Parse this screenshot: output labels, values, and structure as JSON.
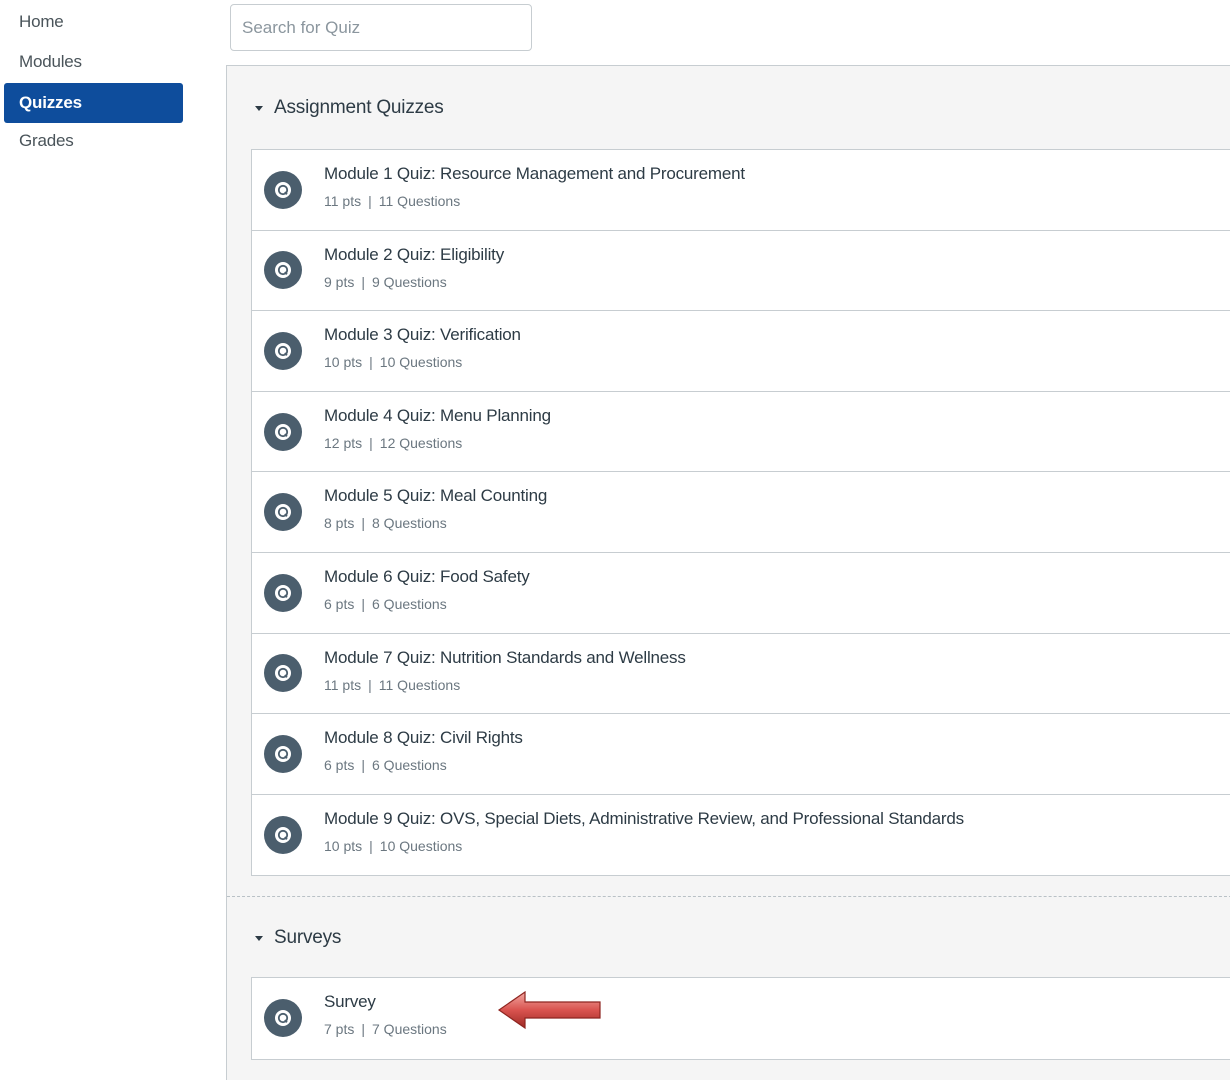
{
  "nav": {
    "items": [
      {
        "label": "Home",
        "active": false
      },
      {
        "label": "Modules",
        "active": false
      },
      {
        "label": "Quizzes",
        "active": true
      },
      {
        "label": "Grades",
        "active": false
      }
    ]
  },
  "search": {
    "placeholder": "Search for Quiz",
    "value": ""
  },
  "groups": [
    {
      "title": "Assignment Quizzes",
      "quizzes": [
        {
          "title": "Module 1 Quiz: Resource Management and Procurement",
          "pts": "11 pts",
          "questions": "11 Questions"
        },
        {
          "title": "Module 2 Quiz: Eligibility",
          "pts": "9 pts",
          "questions": "9 Questions"
        },
        {
          "title": "Module 3 Quiz: Verification",
          "pts": "10 pts",
          "questions": "10 Questions"
        },
        {
          "title": "Module 4 Quiz: Menu Planning",
          "pts": "12 pts",
          "questions": "12 Questions"
        },
        {
          "title": "Module 5 Quiz: Meal Counting",
          "pts": "8 pts",
          "questions": "8 Questions"
        },
        {
          "title": "Module 6 Quiz: Food Safety",
          "pts": "6 pts",
          "questions": "6 Questions"
        },
        {
          "title": "Module 7 Quiz: Nutrition Standards and Wellness",
          "pts": "11 pts",
          "questions": "11 Questions"
        },
        {
          "title": "Module 8 Quiz: Civil Rights",
          "pts": "6 pts",
          "questions": "6 Questions"
        },
        {
          "title": "Module 9 Quiz: OVS, Special Diets, Administrative Review, and Professional Standards",
          "pts": "10 pts",
          "questions": "10 Questions"
        }
      ]
    },
    {
      "title": "Surveys",
      "quizzes": [
        {
          "title": "Survey",
          "pts": "7 pts",
          "questions": "7 Questions"
        }
      ]
    }
  ],
  "meta_separator": "|",
  "colors": {
    "nav_active": "#0e4d9c",
    "icon_bg": "#4b5e6d",
    "annotation_arrow": "#c0392b"
  },
  "icons": {
    "quiz": "quiz-rocket-icon",
    "caret": "caret-down-icon",
    "annotation": "left-arrow-annotation"
  }
}
